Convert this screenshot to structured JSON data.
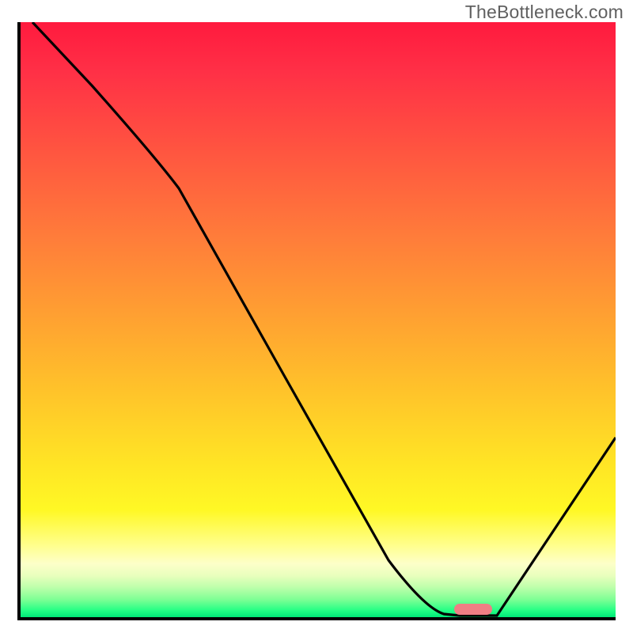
{
  "watermark": "TheBottleneck.com",
  "colors": {
    "gradient_top": "#ff1a3e",
    "gradient_mid": "#ffe425",
    "gradient_bottom": "#00e878",
    "curve": "#000000",
    "marker": "#ef7e84",
    "axis": "#000000"
  },
  "chart_data": {
    "type": "line",
    "title": "",
    "xlabel": "",
    "ylabel": "",
    "xlim": [
      0,
      100
    ],
    "ylim": [
      0,
      100
    ],
    "x": [
      2,
      10,
      20,
      26,
      44,
      62,
      71,
      75,
      80,
      100
    ],
    "y": [
      100,
      90,
      78,
      72,
      40,
      9,
      1,
      0,
      0,
      30
    ],
    "minimum_plateau": {
      "x_start": 73,
      "x_end": 80,
      "y": 0
    },
    "annotations": [
      {
        "type": "marker",
        "shape": "rounded-bar",
        "x": 76.5,
        "y": 0.5,
        "color": "#ef7e84"
      }
    ],
    "background": "vertical-gradient red→yellow→green"
  }
}
